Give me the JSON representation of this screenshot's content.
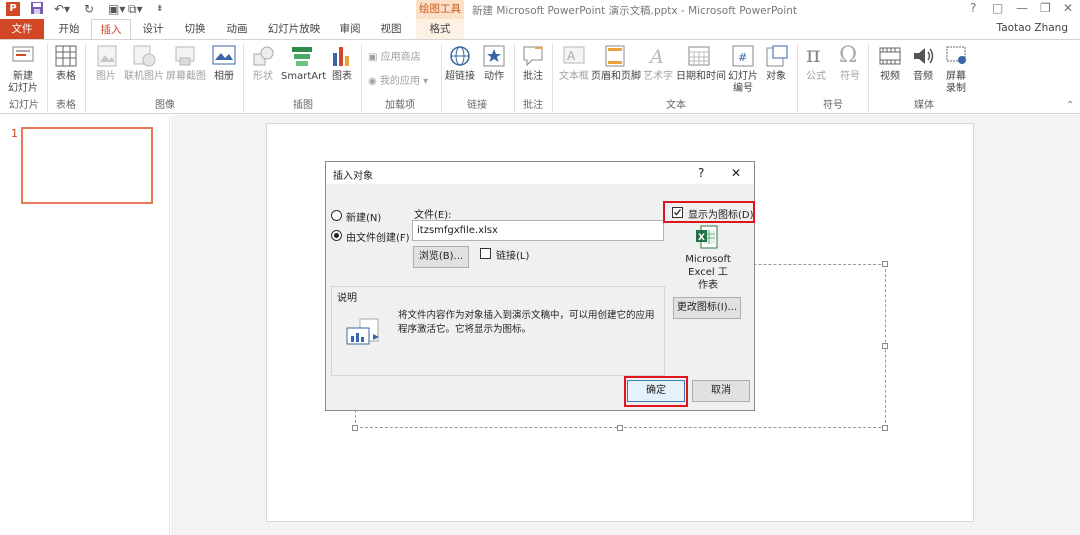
{
  "window": {
    "title": "新建 Microsoft PowerPoint 演示文稿.pptx - Microsoft PowerPoint",
    "context_tool": "绘图工具",
    "controls": [
      "?",
      "□",
      "—",
      "❐",
      "✕"
    ],
    "user": "Taotao Zhang"
  },
  "tabs": [
    {
      "label": "文件"
    },
    {
      "label": "开始"
    },
    {
      "label": "插入"
    },
    {
      "label": "设计"
    },
    {
      "label": "切换"
    },
    {
      "label": "动画"
    },
    {
      "label": "幻灯片放映"
    },
    {
      "label": "审阅"
    },
    {
      "label": "视图"
    },
    {
      "label": "格式"
    }
  ],
  "ribbon": {
    "new_slide": "新建\n幻灯片",
    "table": "表格",
    "picture": "图片",
    "online_picture": "联机图片",
    "screenshot": "屏幕截图",
    "album": "相册",
    "shapes": "形状",
    "smartart": "SmartArt",
    "chart": "图表",
    "store": "应用商店",
    "my_apps": "我的应用",
    "hyperlink": "超链接",
    "action": "动作",
    "comment": "批注",
    "textbox": "文本框",
    "header_footer": "页眉和页脚",
    "wordart": "艺术字",
    "datetime": "日期和时间",
    "slide_number": "幻灯片\n编号",
    "object": "对象",
    "equation": "公式",
    "symbol": "符号",
    "video": "视频",
    "audio": "音频",
    "screen_record": "屏幕\n录制",
    "groups": {
      "slides": "幻灯片",
      "tables": "表格",
      "images": "图像",
      "illustrations": "插图",
      "addins": "加载项",
      "links": "链接",
      "comments": "批注",
      "text": "文本",
      "symbols": "符号",
      "media": "媒体"
    }
  },
  "thumbnail": {
    "number": "1"
  },
  "dialog": {
    "title": "插入对象",
    "help": "?",
    "close": "✕",
    "radio_new": "新建(N)",
    "radio_from_file": "由文件创建(F)",
    "file_label": "文件(E):",
    "file_value": "itzsmfgxfile.xlsx",
    "browse": "浏览(B)...",
    "link": "链接(L)",
    "display_as_icon": "显示为图标(D)",
    "icon_caption": "Microsoft\nExcel 工\n作表",
    "change_icon": "更改图标(I)...",
    "description_title": "说明",
    "description_text": "将文件内容作为对象插入到演示文稿中，可以用创建它的应用程序激活它。它将显示为图标。",
    "ok": "确定",
    "cancel": "取消",
    "display_as_icon_checked": true,
    "from_file_selected": true,
    "highlight_color": "#e0141e"
  },
  "colors": {
    "accent": "#d24726",
    "context": "#fbe1c7"
  }
}
